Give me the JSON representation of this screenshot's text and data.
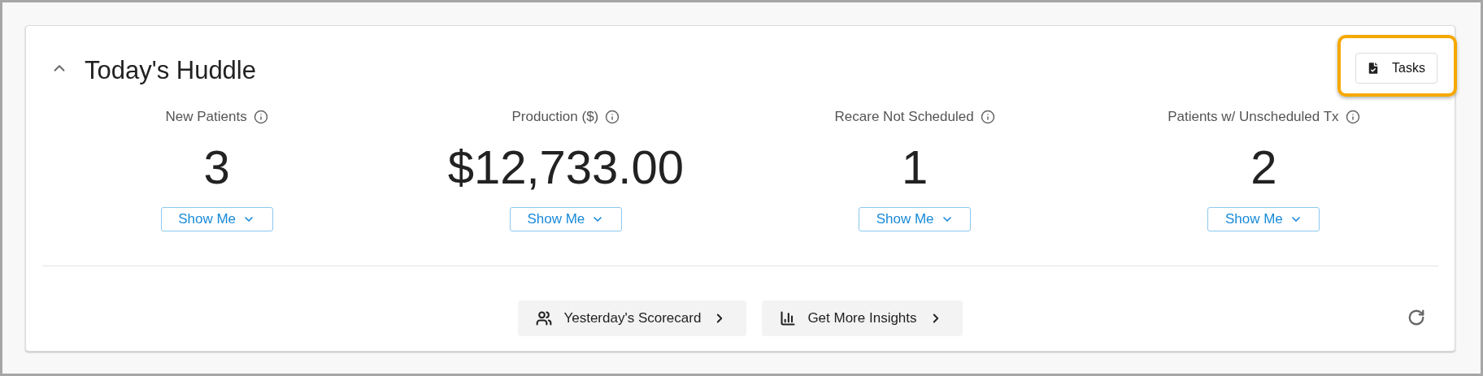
{
  "panel": {
    "title": "Today's Huddle",
    "expanded": true,
    "tasks_button": {
      "label": "Tasks",
      "highlighted": true
    }
  },
  "metrics": [
    {
      "label": "New Patients",
      "value": "3",
      "button": "Show Me"
    },
    {
      "label": "Production ($)",
      "value": "$12,733.00",
      "button": "Show Me"
    },
    {
      "label": "Recare Not Scheduled",
      "value": "1",
      "button": "Show Me"
    },
    {
      "label": "Patients w/ Unscheduled Tx",
      "value": "2",
      "button": "Show Me"
    }
  ],
  "footer_links": [
    {
      "kind": "people",
      "label": "Yesterday's Scorecard"
    },
    {
      "kind": "chart",
      "label": "Get More Insights"
    }
  ]
}
